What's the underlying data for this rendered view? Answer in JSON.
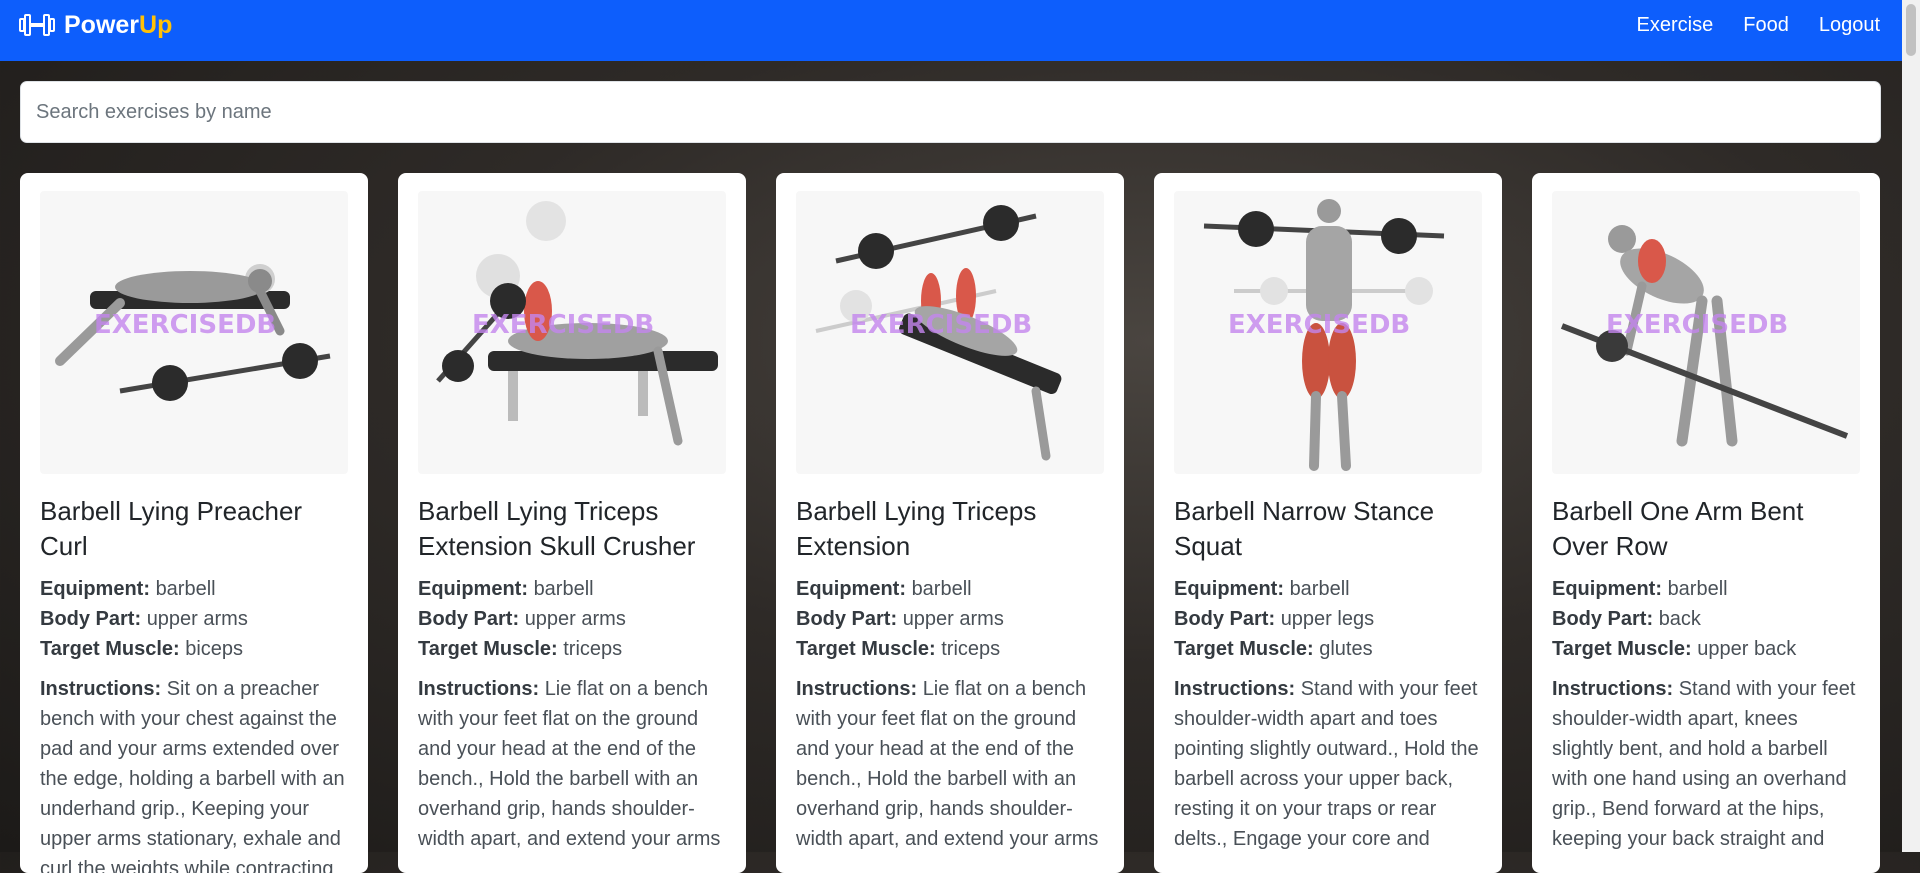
{
  "brand": {
    "name_main": "Power",
    "name_accent": "Up"
  },
  "nav": {
    "links": [
      "Exercise",
      "Food",
      "Logout"
    ]
  },
  "search": {
    "placeholder": "Search exercises by name"
  },
  "labels": {
    "equipment": "Equipment:",
    "body_part": "Body Part:",
    "target": "Target Muscle:",
    "instructions": "Instructions:"
  },
  "image_watermark": "EXERCISEDB",
  "cards": [
    {
      "title": "Barbell Lying Preacher Curl",
      "equipment": "barbell",
      "body_part": "upper arms",
      "target": "biceps",
      "instructions": "Sit on a preacher bench with your chest against the pad and your arms extended over the edge, holding a barbell with an underhand grip., Keeping your upper arms stationary, exhale and curl the weights while contracting"
    },
    {
      "title": "Barbell Lying Triceps Extension Skull Crusher",
      "equipment": "barbell",
      "body_part": "upper arms",
      "target": "triceps",
      "instructions": "Lie flat on a bench with your feet flat on the ground and your head at the end of the bench., Hold the barbell with an overhand grip, hands shoulder-width apart, and extend your arms"
    },
    {
      "title": "Barbell Lying Triceps Extension",
      "equipment": "barbell",
      "body_part": "upper arms",
      "target": "triceps",
      "instructions": "Lie flat on a bench with your feet flat on the ground and your head at the end of the bench., Hold the barbell with an overhand grip, hands shoulder-width apart, and extend your arms"
    },
    {
      "title": "Barbell Narrow Stance Squat",
      "equipment": "barbell",
      "body_part": "upper legs",
      "target": "glutes",
      "instructions": "Stand with your feet shoulder-width apart and toes pointing slightly outward., Hold the barbell across your upper back, resting it on your traps or rear delts., Engage your core and"
    },
    {
      "title": "Barbell One Arm Bent Over Row",
      "equipment": "barbell",
      "body_part": "back",
      "target": "upper back",
      "instructions": "Stand with your feet shoulder-width apart, knees slightly bent, and hold a barbell with one hand using an overhand grip., Bend forward at the hips, keeping your back straight and"
    }
  ]
}
